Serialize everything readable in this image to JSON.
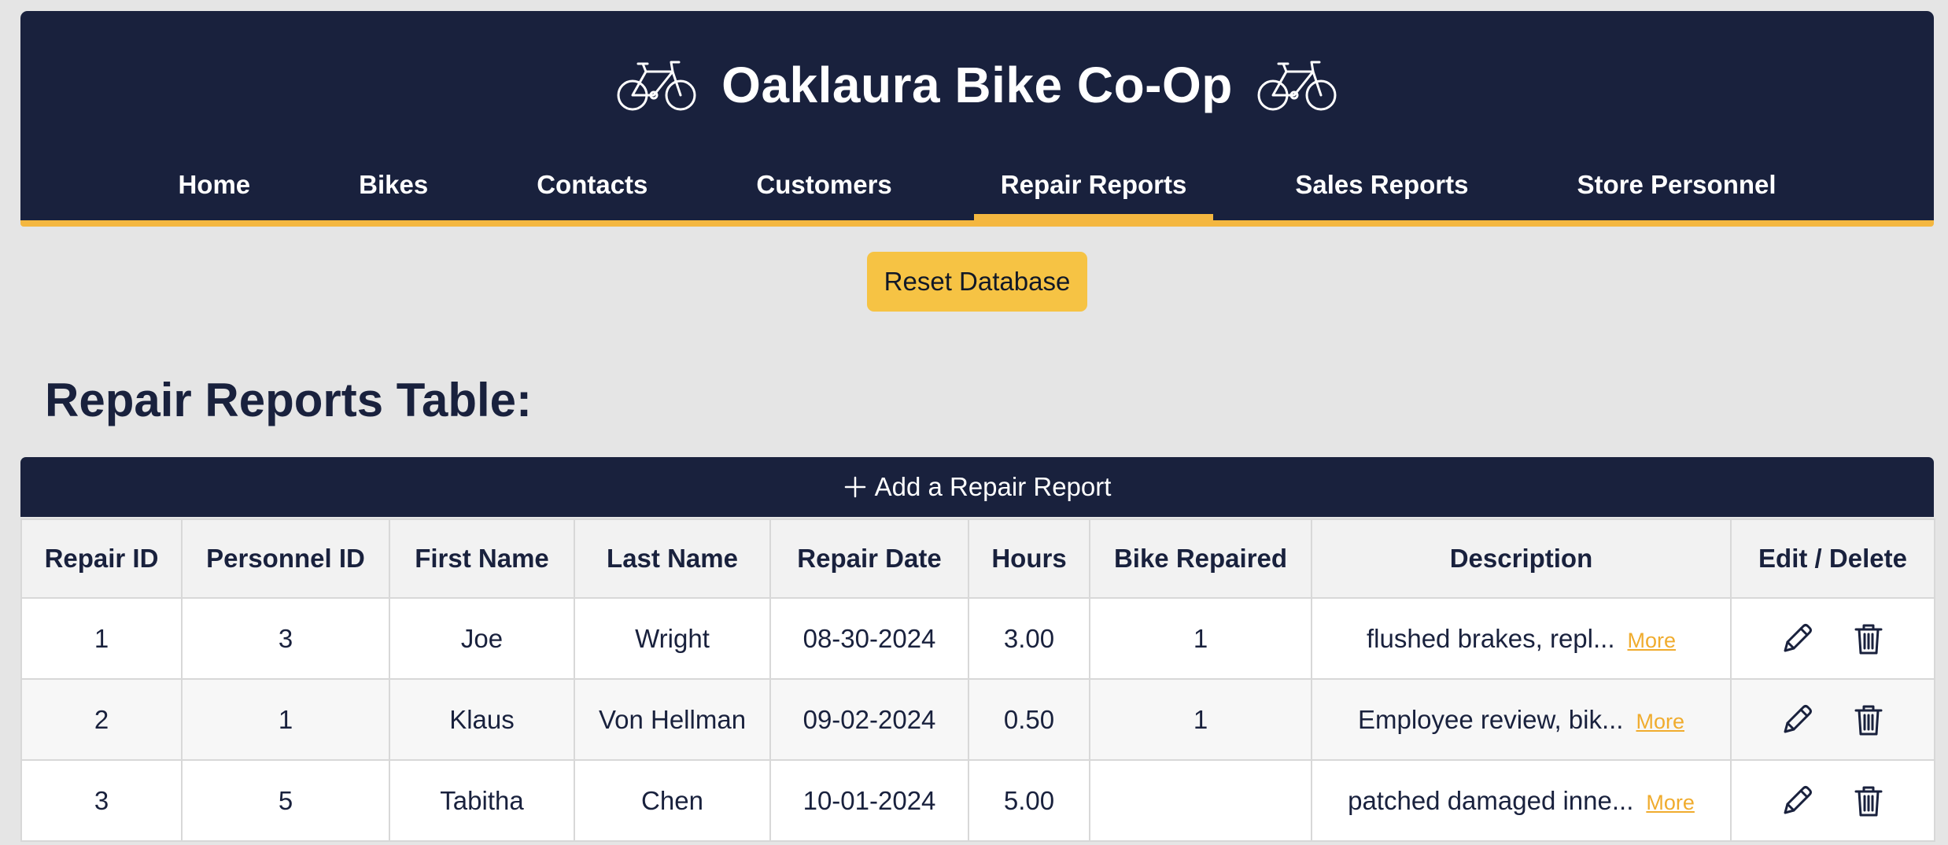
{
  "header": {
    "title": "Oaklaura Bike Co-Op",
    "icons": [
      "bicycle-icon",
      "bicycle-icon"
    ]
  },
  "nav": {
    "items": [
      {
        "label": "Home",
        "active": false
      },
      {
        "label": "Bikes",
        "active": false
      },
      {
        "label": "Contacts",
        "active": false
      },
      {
        "label": "Customers",
        "active": false
      },
      {
        "label": "Repair Reports",
        "active": true
      },
      {
        "label": "Sales Reports",
        "active": false
      },
      {
        "label": "Store Personnel",
        "active": false
      }
    ]
  },
  "actions": {
    "reset_label": "Reset Database"
  },
  "page": {
    "table_title": "Repair Reports Table:",
    "add_label": "Add a Repair Report",
    "add_icon": "plus-icon"
  },
  "table": {
    "columns": [
      "Repair ID",
      "Personnel ID",
      "First Name",
      "Last Name",
      "Repair Date",
      "Hours",
      "Bike Repaired",
      "Description",
      "Edit / Delete"
    ],
    "rows": [
      {
        "repair_id": "1",
        "personnel_id": "3",
        "first_name": "Joe",
        "last_name": "Wright",
        "repair_date": "08-30-2024",
        "hours": "3.00",
        "bike_repaired": "1",
        "description": "flushed brakes, repl...",
        "more": "More"
      },
      {
        "repair_id": "2",
        "personnel_id": "1",
        "first_name": "Klaus",
        "last_name": "Von Hellman",
        "repair_date": "09-02-2024",
        "hours": "0.50",
        "bike_repaired": "1",
        "description": "Employee review, bik...",
        "more": "More"
      },
      {
        "repair_id": "3",
        "personnel_id": "5",
        "first_name": "Tabitha",
        "last_name": "Chen",
        "repair_date": "10-01-2024",
        "hours": "5.00",
        "bike_repaired": "",
        "description": "patched damaged inne...",
        "more": "More"
      }
    ],
    "row_icons": [
      "pencil-icon",
      "trash-icon"
    ]
  },
  "colors": {
    "navy": "#19213d",
    "accent": "#f4b740",
    "button_yellow": "#f6c344",
    "link_orange": "#f0ac2e",
    "background": "#e5e5e5"
  }
}
